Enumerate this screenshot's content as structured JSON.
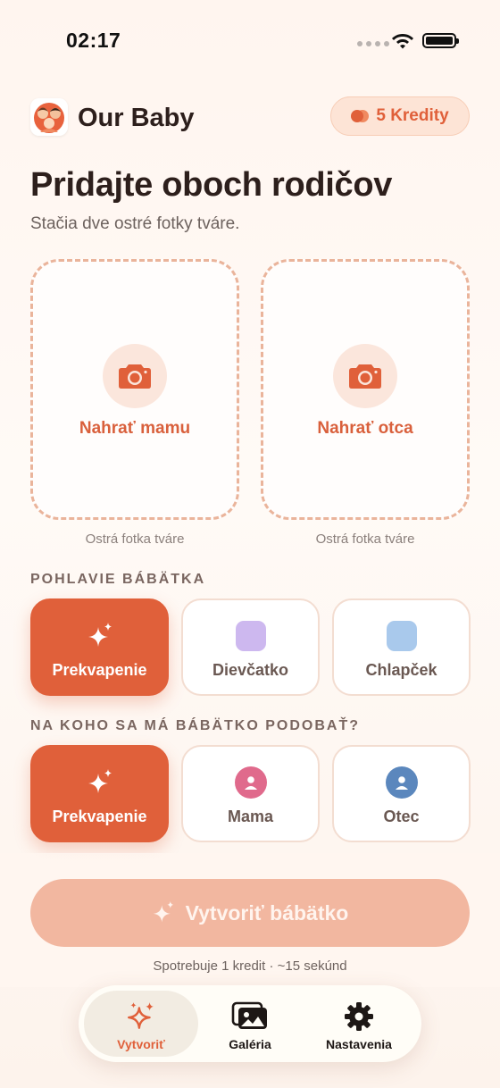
{
  "status": {
    "time": "02:17"
  },
  "header": {
    "app_title": "Our Baby",
    "credits": "5 Kredity"
  },
  "page": {
    "title": "Pridajte oboch rodičov",
    "subtitle": "Stačia dve ostré fotky tváre."
  },
  "uploads": [
    {
      "label": "Nahrať mamu",
      "hint": "Ostrá fotka tváre",
      "icon": "camera-icon"
    },
    {
      "label": "Nahrať otca",
      "hint": "Ostrá fotka tváre",
      "icon": "camera-icon"
    }
  ],
  "gender": {
    "label": "POHLAVIE BÁBÄTKA",
    "options": [
      {
        "label": "Prekvapenie",
        "icon": "sparkles-icon",
        "selected": true
      },
      {
        "label": "Dievčatko",
        "icon": "purple-square-icon",
        "selected": false
      },
      {
        "label": "Chlapček",
        "icon": "blue-square-icon",
        "selected": false
      }
    ]
  },
  "resembles": {
    "label": "NA KOHO SA MÁ BÁBÄTKO PODOBAŤ?",
    "options": [
      {
        "label": "Prekvapenie",
        "icon": "sparkles-icon",
        "selected": true
      },
      {
        "label": "Mama",
        "icon": "person-icon",
        "selected": false
      },
      {
        "label": "Otec",
        "icon": "person-icon",
        "selected": false
      }
    ]
  },
  "cta": {
    "label": "Vytvoriť bábätko",
    "caption": "Spotrebuje 1 kredit · ~15 sekúnd"
  },
  "tabs": [
    {
      "label": "Vytvoriť",
      "icon": "sparkles-icon",
      "active": true
    },
    {
      "label": "Galéria",
      "icon": "gallery-icon",
      "active": false
    },
    {
      "label": "Nastavenia",
      "icon": "gear-icon",
      "active": false
    }
  ],
  "colors": {
    "accent": "#e0603a",
    "accent_soft": "#fbe6dc",
    "girl": "#cdb8ef",
    "boy": "#a9c9ec",
    "mom": "#e06a8c",
    "dad": "#5b87bd"
  }
}
